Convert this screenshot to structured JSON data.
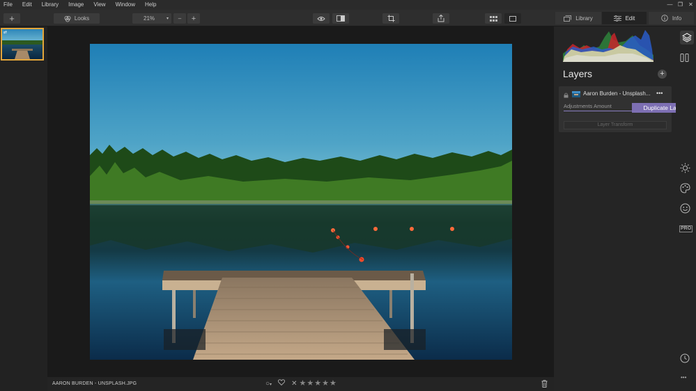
{
  "menu": [
    "File",
    "Edit",
    "Library",
    "Image",
    "View",
    "Window",
    "Help"
  ],
  "window_controls": [
    "—",
    "❐",
    "✕"
  ],
  "toolbar": {
    "add_label": "+",
    "looks_label": "Looks",
    "zoom_value": "21%",
    "zoom_out": "–",
    "zoom_in": "+",
    "tabs": [
      {
        "label": "Library",
        "icon": "library-icon"
      },
      {
        "label": "Edit",
        "icon": "sliders-icon",
        "active": true
      },
      {
        "label": "Info",
        "icon": "info-icon"
      }
    ]
  },
  "status": {
    "filename": "AARON BURDEN - UNSPLASH.JPG",
    "reject": "✕",
    "stars": [
      "★",
      "★",
      "★",
      "★",
      "★"
    ],
    "flag": "○",
    "flag_arrow": "▾"
  },
  "layers_panel": {
    "title": "Layers",
    "add": "+",
    "layer": {
      "name": "Aaron Burden - Unsplash...",
      "more": "•••",
      "adjustments_label": "Adjustments Amount",
      "transform_label": "Layer Transform"
    },
    "tooltip": "Duplicate Layer"
  },
  "iconbar": {
    "pro_label": "PRO",
    "more": "•••"
  },
  "colors": {
    "accent": "#e3a63b",
    "tooltip": "#7d6fb3"
  }
}
